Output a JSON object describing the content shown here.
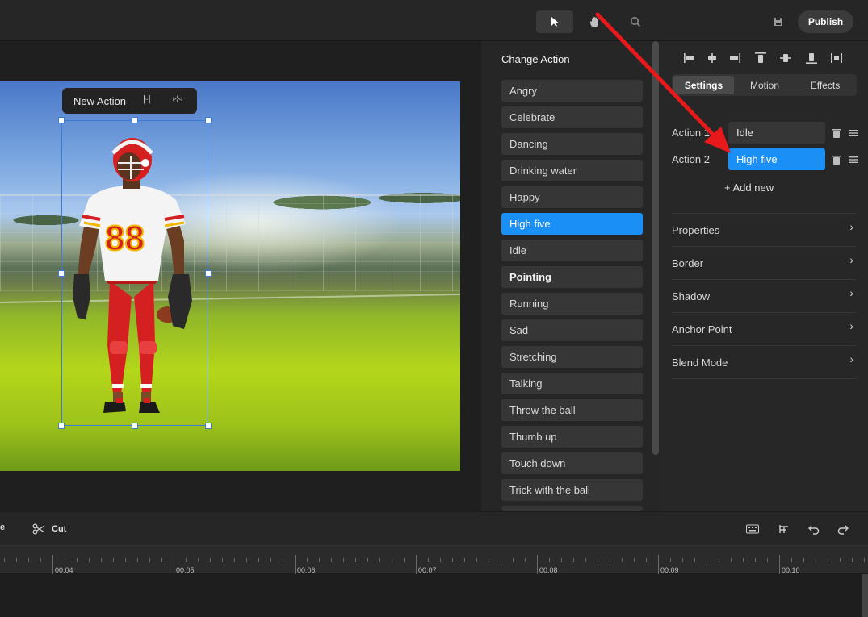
{
  "topbar": {
    "tools": [
      "select-pointer-icon",
      "hand-pan-icon",
      "zoom-search-icon"
    ],
    "publish_label": "Publish"
  },
  "canvas": {
    "new_action_label": "New Action"
  },
  "change_action": {
    "title": "Change Action",
    "items": [
      {
        "label": "Angry"
      },
      {
        "label": "Celebrate"
      },
      {
        "label": "Dancing"
      },
      {
        "label": "Drinking water"
      },
      {
        "label": "Happy"
      },
      {
        "label": "High five",
        "selected": true
      },
      {
        "label": "Idle"
      },
      {
        "label": "Pointing"
      },
      {
        "label": "Running"
      },
      {
        "label": "Sad"
      },
      {
        "label": "Stretching"
      },
      {
        "label": "Talking"
      },
      {
        "label": "Throw the ball"
      },
      {
        "label": "Thumb up"
      },
      {
        "label": "Touch down"
      },
      {
        "label": "Trick with the ball"
      }
    ]
  },
  "right_panel": {
    "tabs": [
      {
        "label": "Settings",
        "active": true
      },
      {
        "label": "Motion"
      },
      {
        "label": "Effects"
      }
    ],
    "actions": [
      {
        "label": "Action 1",
        "value": "Idle"
      },
      {
        "label": "Action 2",
        "value": "High five"
      }
    ],
    "add_new_label": "+ Add new",
    "sections": [
      "Properties",
      "Border",
      "Shadow",
      "Anchor Point",
      "Blend Mode"
    ],
    "accent_color": "#1a8ff5"
  },
  "timeline": {
    "left_label": "e",
    "cut_label": "Cut",
    "ticks": [
      "00:04",
      "00:05",
      "00:06",
      "00:07",
      "00:08",
      "00:09",
      "00:10"
    ]
  },
  "annotation": {
    "arrow_color": "#e8191b"
  }
}
